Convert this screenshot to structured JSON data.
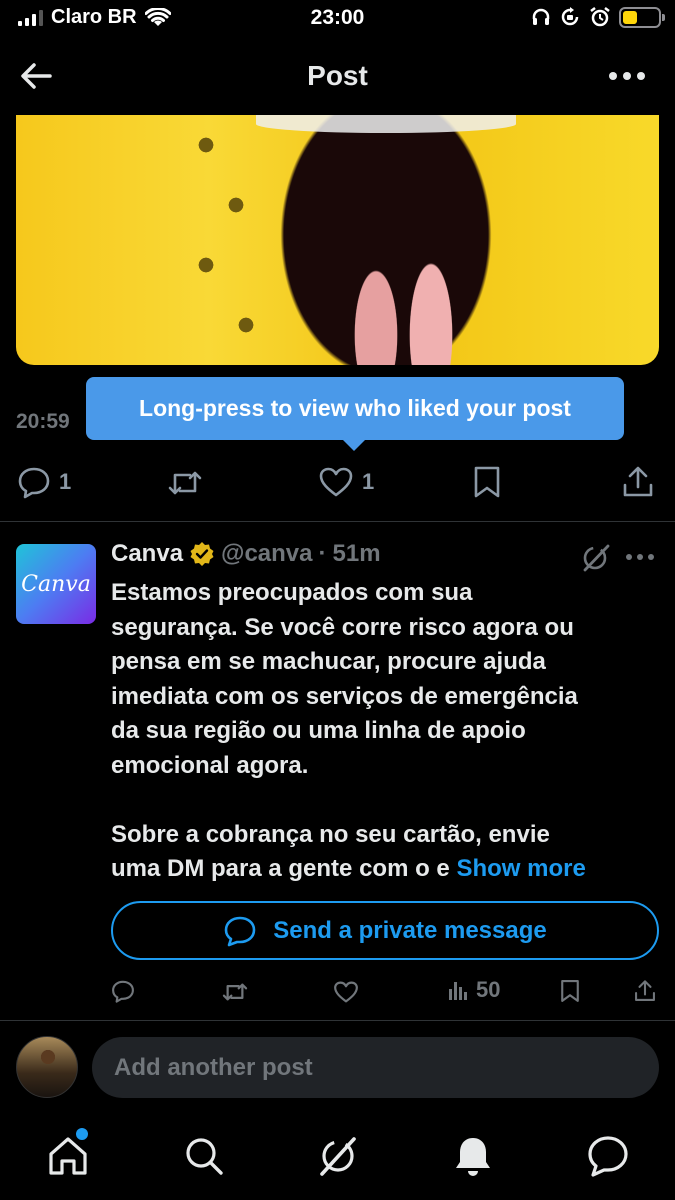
{
  "status_bar": {
    "carrier": "Claro BR",
    "time": "23:00",
    "battery_level": 0.4
  },
  "header": {
    "title": "Post",
    "back_icon": "arrow-left-icon",
    "more_icon": "ellipsis-horizontal-icon"
  },
  "post": {
    "time_partial": "20:59",
    "tooltip": "Long-press to view who liked your post",
    "actions": {
      "replies": "1",
      "likes": "1"
    }
  },
  "reply": {
    "avatar_text": "Canva",
    "name": "Canva",
    "handle": "@canva",
    "separator": "·",
    "time": "51m",
    "text_lines": [
      "Estamos preocupados com sua",
      "segurança. Se você corre risco agora ou",
      "pensa em se machucar, procure ajuda",
      "imediata com os serviços de emergência",
      "da sua região ou uma linha de apoio",
      "emocional agora."
    ],
    "text_lines_2": [
      "Sobre a cobrança no seu cartão, envie"
    ],
    "last_line": "uma DM para a gente com o e",
    "show_more": "Show more",
    "dm_button": "Send a private message",
    "views": "50"
  },
  "composer": {
    "placeholder": "Add another post"
  },
  "colors": {
    "accent": "#1d9bf0",
    "tooltip": "#4a99e9",
    "background": "#000000",
    "muted": "#71767b"
  }
}
